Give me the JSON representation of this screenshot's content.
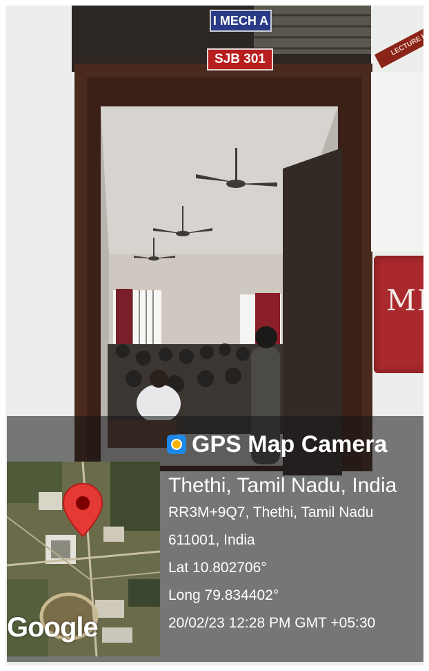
{
  "signs": {
    "class_label": "I MECH A",
    "room_label": "SJB 301",
    "lecture_sign": "LECTURE HA",
    "board_text": "MEC"
  },
  "overlay": {
    "app_name": "GPS Map Camera",
    "app_icon": "gps-camera-icon",
    "location_title": "Thethi, Tamil Nadu, India",
    "address_line1": "RR3M+9Q7, Thethi, Tamil Nadu",
    "address_line2": "611001, India",
    "latitude": "Lat 10.802706°",
    "longitude": "Long 79.834402°",
    "timestamp": "20/02/23 12:28 PM GMT +05:30",
    "map_logo": "Google",
    "pin_color": "#e53935"
  }
}
